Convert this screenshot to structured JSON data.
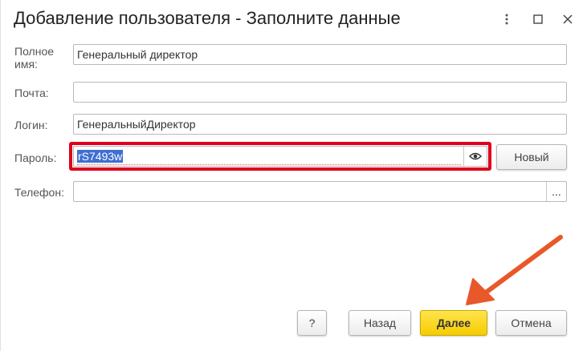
{
  "window": {
    "title": "Добавление пользователя - Заполните данные",
    "menu_icon": "more-vertical-icon",
    "maximize_icon": "maximize-icon",
    "close_icon": "close-icon"
  },
  "form": {
    "full_name_label": "Полное имя:",
    "full_name_value": "Генеральный директор",
    "email_label": "Почта:",
    "email_value": "",
    "login_label": "Логин:",
    "login_value": "ГенеральныйДиректор",
    "password_label": "Пароль:",
    "password_value": "rS7493w",
    "new_password_button": "Новый",
    "phone_label": "Телефон:",
    "phone_value": "",
    "phone_select_button": "..."
  },
  "footer": {
    "help_button": "?",
    "back_button": "Назад",
    "next_button": "Далее",
    "cancel_button": "Отмена"
  },
  "colors": {
    "highlight_frame": "#e0001b",
    "primary_button": "#f5cc00",
    "annotation_arrow": "#e8582a",
    "selection": "#3f6fd1"
  }
}
